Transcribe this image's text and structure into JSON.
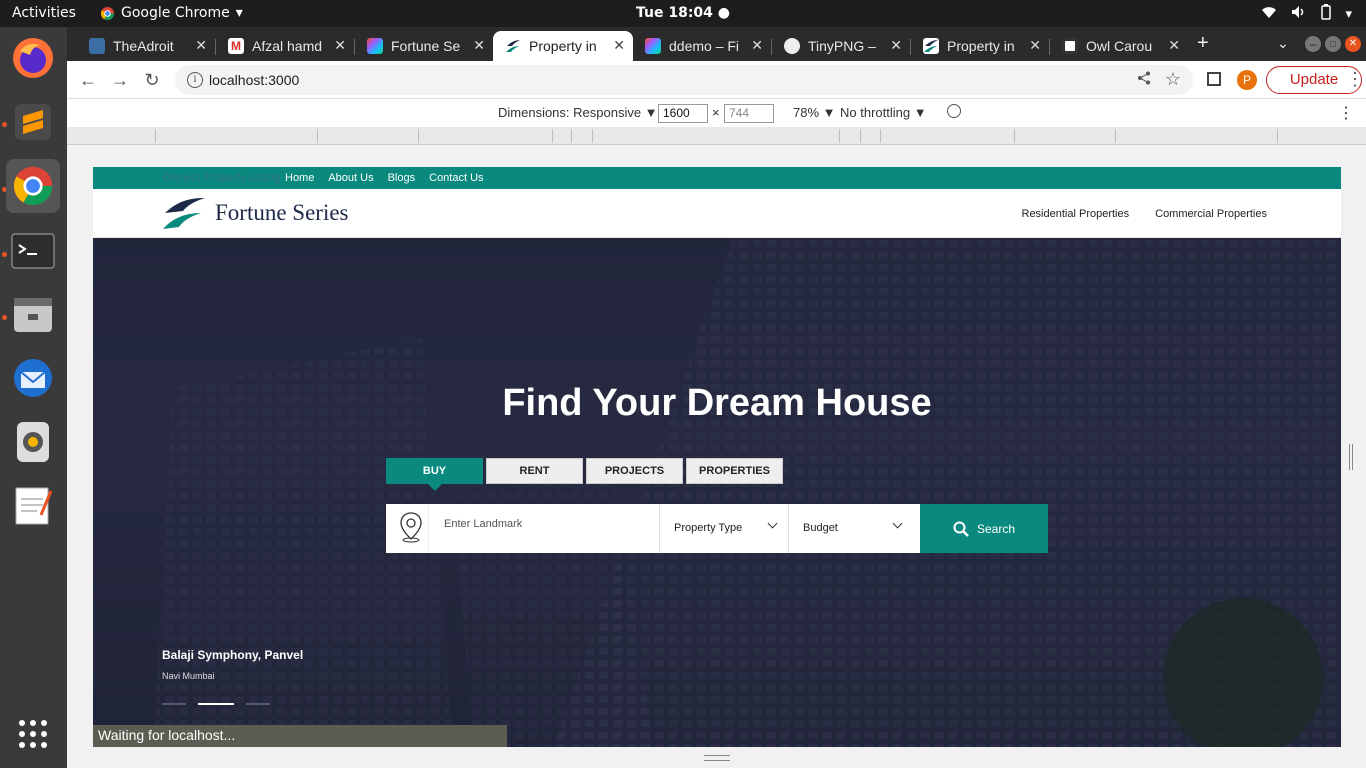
{
  "system": {
    "activities": "Activities",
    "app_name": "Google Chrome",
    "clock": "Tue 18:04"
  },
  "dock": {
    "items": [
      "firefox-icon",
      "sublime-text-icon",
      "chrome-icon",
      "terminal-icon",
      "files-icon",
      "thunderbird-icon",
      "rhythmbox-icon",
      "text-editor-icon",
      "app-grid-icon"
    ]
  },
  "tabs": [
    {
      "title": "TheAdroit"
    },
    {
      "title": "Afzal hamd"
    },
    {
      "title": "Fortune Se"
    },
    {
      "title": "Property in",
      "active": true
    },
    {
      "title": "ddemo – Fi"
    },
    {
      "title": "TinyPNG – "
    },
    {
      "title": "Property in"
    },
    {
      "title": "Owl Carou"
    }
  ],
  "toolbar": {
    "url": "localhost:3000",
    "profile_initial": "P",
    "update_label": "Update"
  },
  "devtools": {
    "dimensions": "Dimensions: Responsive ▼",
    "width": "1600",
    "times": "×",
    "height": "744",
    "zoom": "78% ▼",
    "throttling": "No throttling ▼"
  },
  "site": {
    "topbar": {
      "owners": "Owners Property Listing",
      "nav": [
        "Home",
        "About Us",
        "Blogs",
        "Contact Us"
      ]
    },
    "logo_text": "Fortune Series",
    "header_links": [
      "Residential Properties",
      "Commercial Properties"
    ],
    "hero": {
      "title": "Find Your Dream House",
      "tabs": [
        "BUY",
        "RENT",
        "PROJECTS",
        "PROPERTIES"
      ],
      "landmark_placeholder": "Enter Landmark",
      "property_type": "Property Type",
      "budget": "Budget",
      "search_label": "Search",
      "caption_title": "Balaji Symphony, Panvel",
      "caption_sub": "Navi Mumbai"
    }
  },
  "status": "Waiting for localhost...",
  "colors": {
    "accent": "#0a8a7e",
    "update_red": "#c5221f"
  }
}
